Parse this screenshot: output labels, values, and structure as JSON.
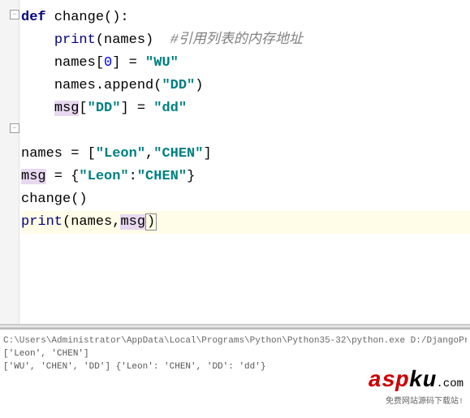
{
  "code": {
    "l1_def": "def",
    "l1_name": " change",
    "l1_paren": "():",
    "l2_print": "print",
    "l2_open": "(",
    "l2_arg": "names",
    "l2_close": ")",
    "l2_comment": "  #引用列表的内存地址",
    "l3_a": "names[",
    "l3_idx": "0",
    "l3_b": "] = ",
    "l3_str": "\"WU\"",
    "l4_a": "names.append(",
    "l4_str": "\"DD\"",
    "l4_b": ")",
    "l5_var": "msg",
    "l5_a": "[",
    "l5_key": "\"DD\"",
    "l5_b": "] = ",
    "l5_val": "\"dd\"",
    "l7_a": "names = [",
    "l7_s1": "\"Leon\"",
    "l7_c": ",",
    "l7_s2": "\"CHEN\"",
    "l7_b": "]",
    "l8_var": "msg",
    "l8_a": " = {",
    "l8_k": "\"Leon\"",
    "l8_c": ":",
    "l8_v": "\"CHEN\"",
    "l8_b": "}",
    "l9": "change()",
    "l10_print": "print",
    "l10_open": "(",
    "l10_a1": "names",
    "l10_c": ",",
    "l10_a2": "msg",
    "l10_close": ")"
  },
  "terminal": {
    "cmd": "C:\\Users\\Administrator\\AppData\\Local\\Programs\\Python\\Python35-32\\python.exe D:/DjangoProj/Jumpse",
    "out1": "['Leon', 'CHEN']",
    "out2": "['WU', 'CHEN', 'DD'] {'Leon': 'CHEN', 'DD': 'dd'}"
  },
  "watermark": {
    "asp": "asp",
    "ku": "ku",
    "com": ".com",
    "sub": "免费网站源码下载站!"
  },
  "fold_symbol": "−"
}
